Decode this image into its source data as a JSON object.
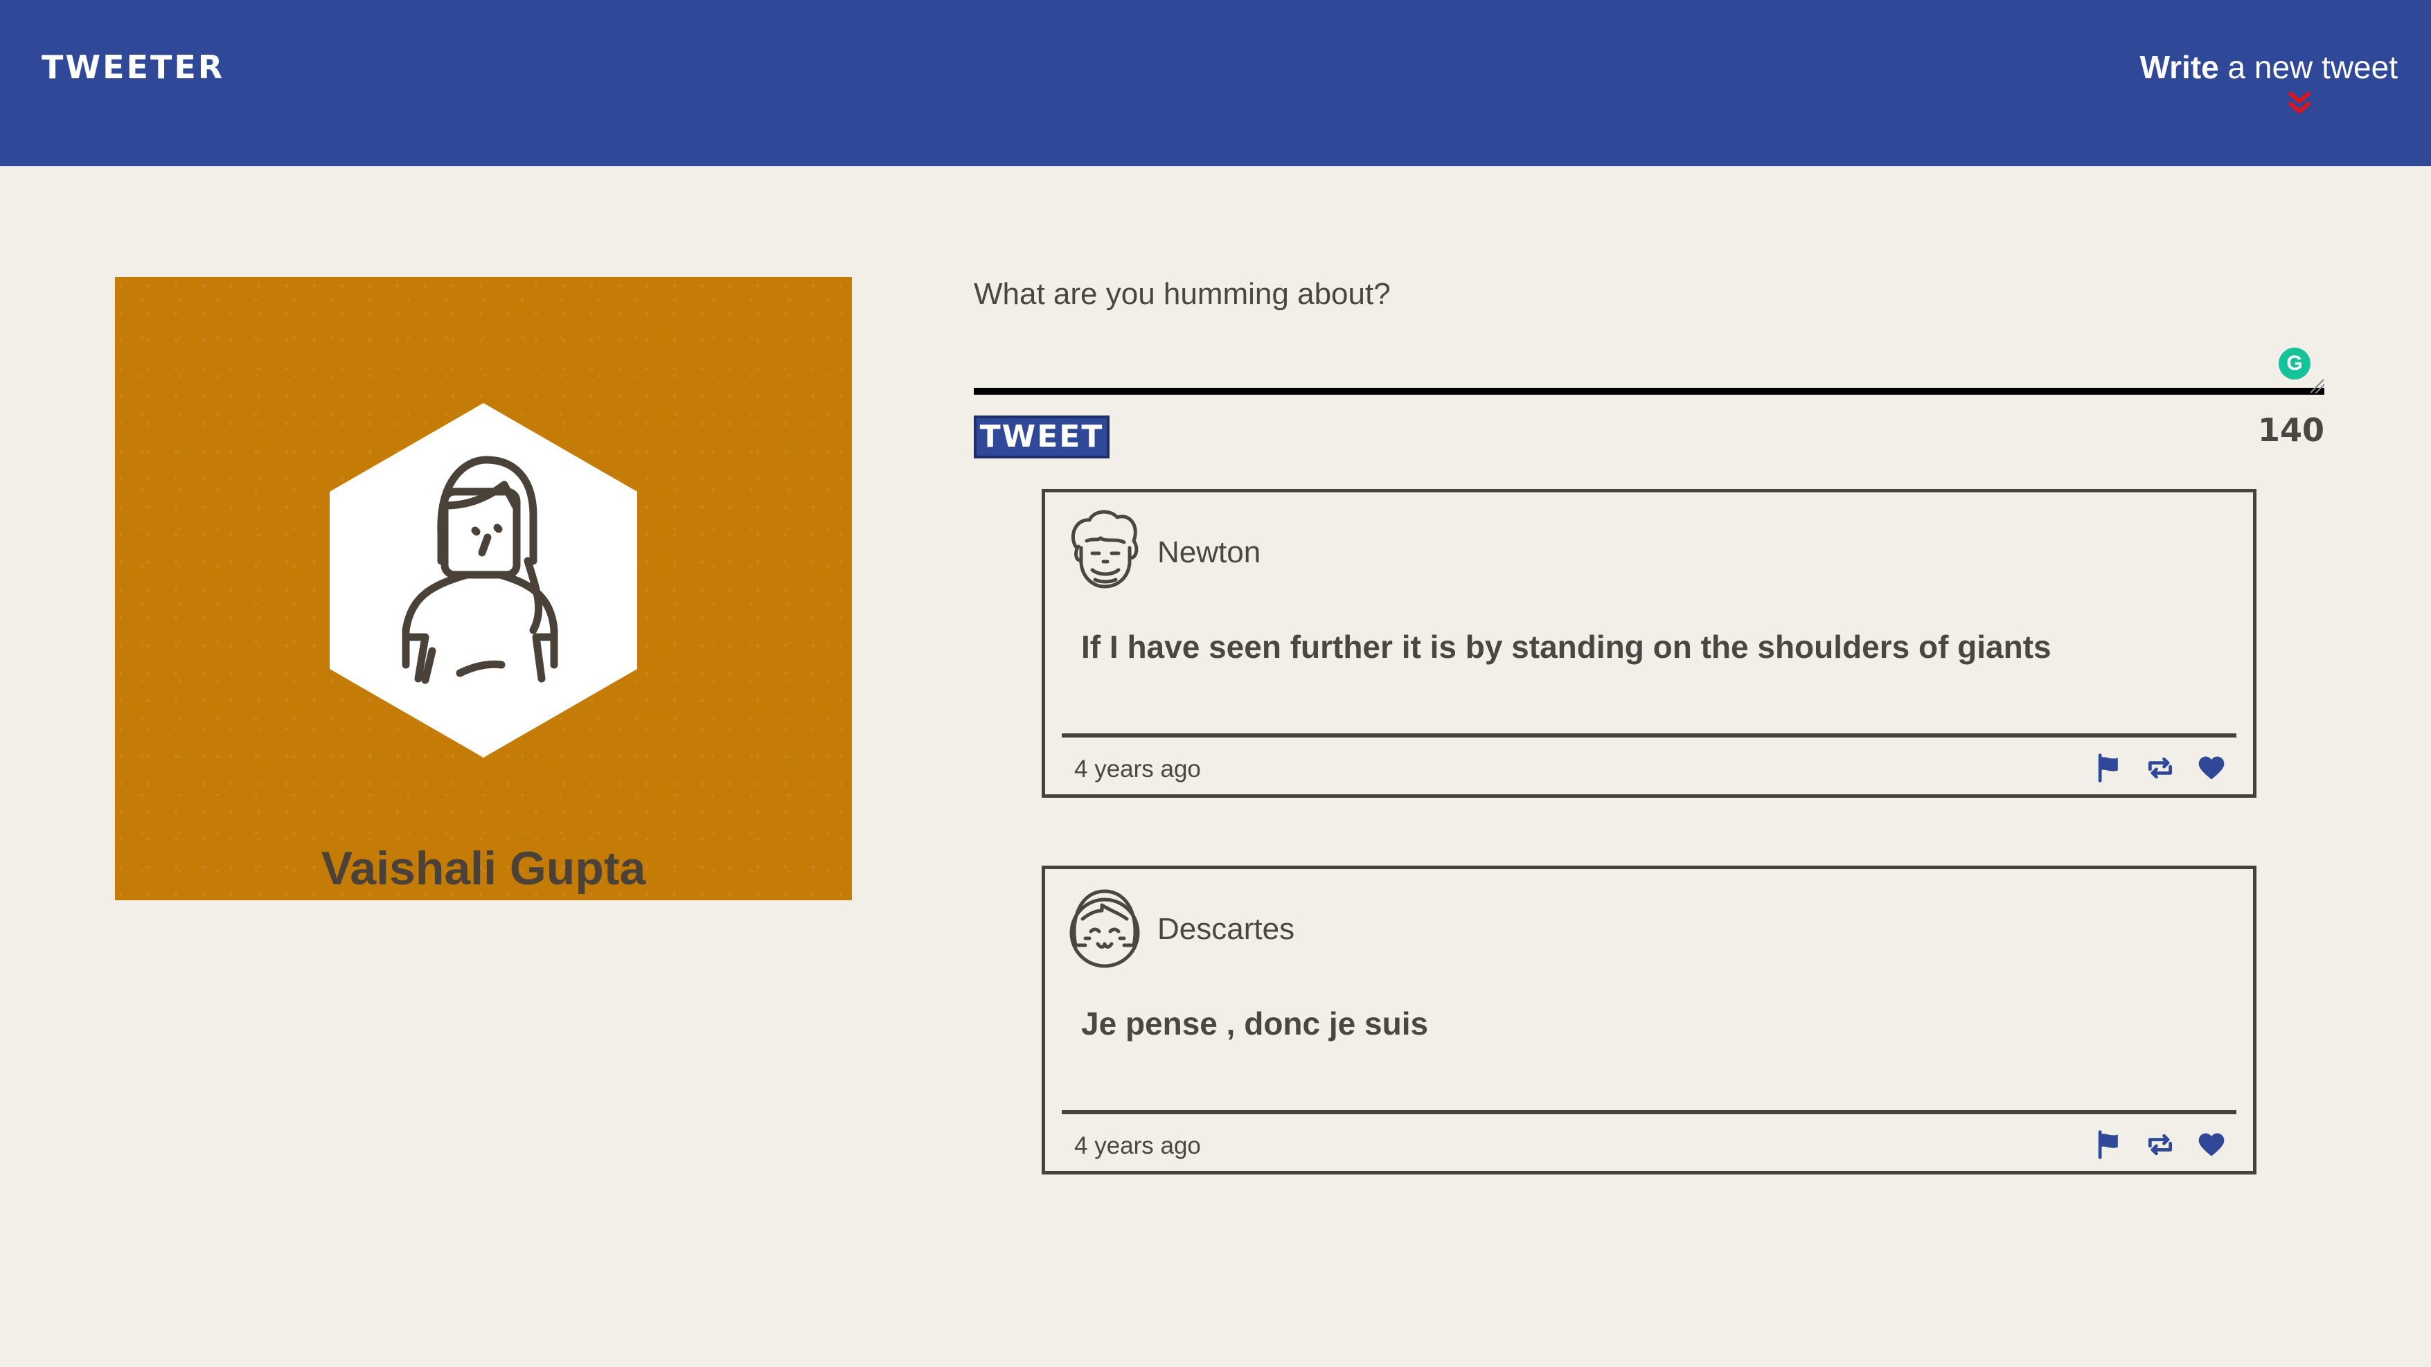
{
  "header": {
    "brand": "TWEETER",
    "compose_bold": "Write",
    "compose_rest": " a new tweet",
    "toggle_icon": "double-chevron-down-icon",
    "toggle_color": "#e0141e"
  },
  "profile": {
    "name": "Vaishali Gupta",
    "avatar_icon": "woman-avatar-icon",
    "background_color": "#c57c06"
  },
  "composer": {
    "placeholder": "What are you humming about?",
    "value": "",
    "submit_label": "TWEET",
    "char_counter": "140"
  },
  "tweets": [
    {
      "handle": "Newton",
      "avatar_icon": "curly-hair-man-avatar-icon",
      "text": "If I have seen further it is by standing on the shoulders of giants",
      "timestamp": "4 years ago",
      "actions": [
        "flag-icon",
        "retweet-icon",
        "heart-icon"
      ]
    },
    {
      "handle": "Descartes",
      "avatar_icon": "bob-hair-avatar-icon",
      "text": "Je pense , donc je suis",
      "timestamp": "4 years ago",
      "actions": [
        "flag-icon",
        "retweet-icon",
        "heart-icon"
      ]
    }
  ],
  "colors": {
    "nav": "#304898",
    "page_bg": "#f2efe9",
    "ink": "#4a4640",
    "action_icons": "#304898"
  }
}
